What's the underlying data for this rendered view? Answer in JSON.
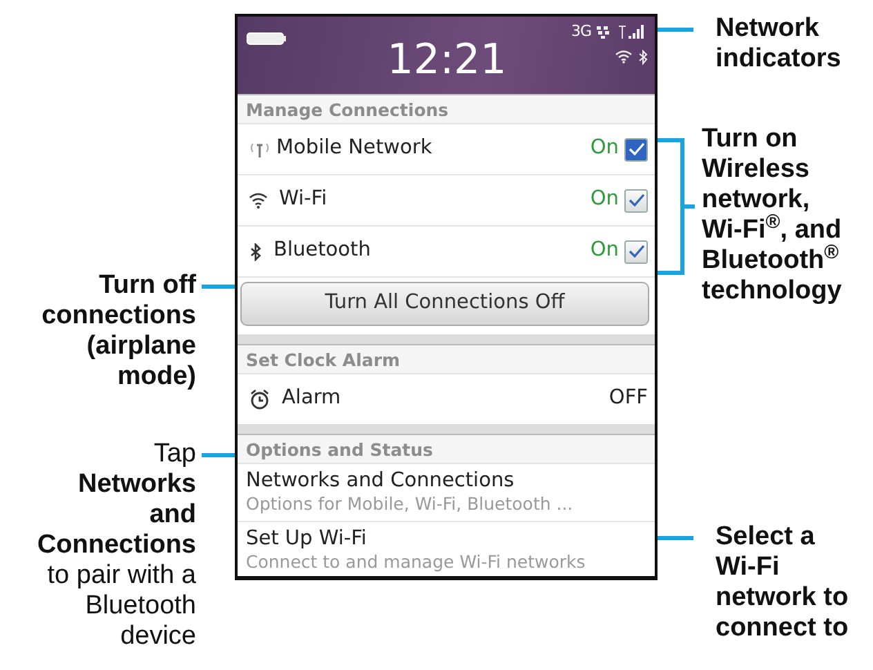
{
  "callouts_left": [
    {
      "text": "**Turn off** connections (airplane mode)"
    },
    {
      "text": "Tap **Networks and Connections** to pair with a Bluetooth device"
    }
  ],
  "phone": {
    "status_bar": {
      "network_type": "3G",
      "time": "12:21"
    },
    "sections": [
      {
        "title": "Manage Connections",
        "items": [
          {
            "kind": "toggle",
            "label": "Mobile Network",
            "value": "On",
            "checked": true,
            "focused": true
          },
          {
            "kind": "toggle",
            "label": "Wi-Fi",
            "value": "On",
            "checked": true,
            "focused": false
          },
          {
            "kind": "toggle",
            "label": "Bluetooth",
            "value": "On",
            "checked": true,
            "focused": false
          },
          {
            "kind": "button",
            "label": "Turn All Connections Off"
          }
        ]
      },
      {
        "title": "Set Clock Alarm",
        "items": [
          {
            "kind": "setting",
            "label": "Alarm",
            "value": "OFF"
          }
        ]
      },
      {
        "title": "Options and Status",
        "items": [
          {
            "kind": "link",
            "label": "Networks and Connections",
            "subtitle": "Options for Mobile, Wi-Fi, Bluetooth ..."
          },
          {
            "kind": "link",
            "label": "Set Up Wi-Fi",
            "subtitle": "Connect to and manage Wi-Fi networks"
          }
        ]
      }
    ]
  },
  "callouts_right": [
    {
      "kind": "line",
      "text": "Network indicators"
    },
    {
      "kind": "bracket",
      "text": "Turn on Wireless network, Wi-Fi$^{®}$, and Bluetooth$^{®}$ technology"
    },
    {
      "kind": "line",
      "text": "Select a Wi-Fi network to connect to"
    }
  ]
}
